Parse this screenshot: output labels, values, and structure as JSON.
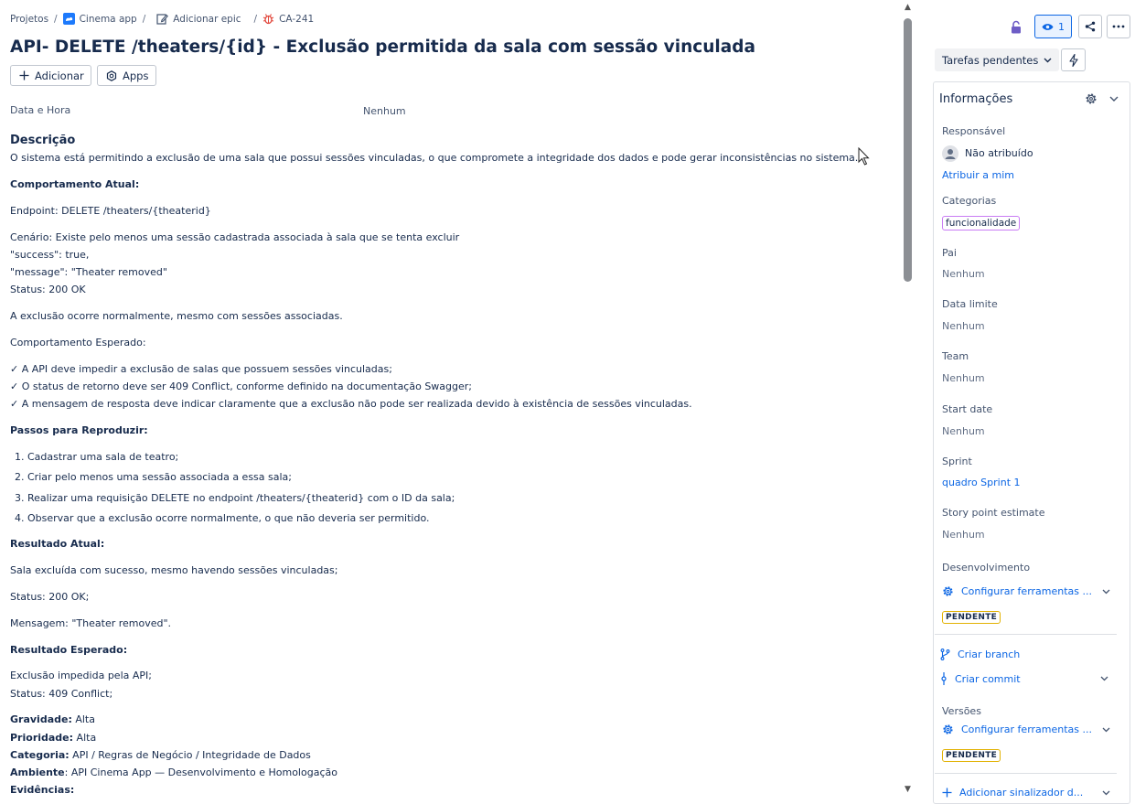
{
  "breadcrumb": {
    "projects": "Projetos",
    "project": "Cinema app",
    "epic": "Adicionar epic",
    "issue_key": "CA-241"
  },
  "issue": {
    "title": "API- DELETE /theaters/{id} - Exclusão permitida da sala com sessão vinculada",
    "add_button": "Adicionar",
    "apps_button": "Apps"
  },
  "fields": {
    "datetime_label": "Data e Hora",
    "datetime_value": "Nenhum"
  },
  "description": {
    "heading": "Descrição",
    "intro": "O sistema está permitindo a exclusão de uma sala que possui sessões vinculadas, o que compromete a integridade dos dados e pode gerar inconsistências no sistema.",
    "current_behavior_title": "Comportamento Atual:",
    "endpoint": "Endpoint: DELETE /theaters/{theaterid}",
    "scenario": "Cenário: Existe pelo menos uma sessão cadastrada associada à sala que se tenta excluir",
    "success_line": "\"success\": true,",
    "message_line": "\"message\": \"Theater removed\"",
    "status_line": "Status: 200 OK",
    "normal_deletion": "A exclusão ocorre normalmente, mesmo com sessões associadas.",
    "expected_behavior_title": "Comportamento Esperado:",
    "expected": [
      "✓ A API deve impedir a exclusão de salas que possuem sessões vinculadas;",
      "✓ O status de retorno deve ser 409 Conflict, conforme definido na documentação Swagger;",
      "✓ A mensagem de resposta deve indicar claramente que a exclusão não pode ser realizada devido à existência de sessões vinculadas."
    ],
    "steps_title": "Passos para Reproduzir:",
    "steps": [
      "Cadastrar uma sala de teatro;",
      "Criar pelo menos uma sessão associada a essa sala;",
      "Realizar uma requisição DELETE no endpoint /theaters/{theaterid} com o ID da sala;",
      "Observar que a exclusão ocorre normalmente, o que não deveria ser permitido."
    ],
    "actual_result_title": "Resultado Atual:",
    "actual_result_1": "Sala excluída com sucesso, mesmo havendo sessões vinculadas;",
    "actual_result_2": "Status: 200 OK;",
    "actual_result_3": "Mensagem: \"Theater removed\".",
    "expected_result_title": "Resultado Esperado:",
    "expected_result_1": "Exclusão impedida pela API;",
    "expected_result_2": "Status: 409 Conflict;",
    "severity_label": "Gravidade:",
    "severity_value": " Alta",
    "priority_label": "Prioridade:",
    "priority_value": " Alta",
    "category_label": "Categoria:",
    "category_value": " API / Regras de Negócio / Integridade de Dados",
    "environment_label": "Ambiente",
    "environment_value": ": API Cinema App — Desenvolvimento e Homologação",
    "evidence_label": "Evidências:"
  },
  "sidebar": {
    "watch_count": "1",
    "pending_tasks": "Tarefas pendentes",
    "info_title": "Informações",
    "assignee_label": "Responsável",
    "assignee_value": "Não atribuído",
    "assign_to_me": "Atribuir a mim",
    "categories_label": "Categorias",
    "category_tag": "funcionalidade",
    "parent_label": "Pai",
    "parent_value": "Nenhum",
    "due_date_label": "Data limite",
    "due_date_value": "Nenhum",
    "team_label": "Team",
    "team_value": "Nenhum",
    "start_date_label": "Start date",
    "start_date_value": "Nenhum",
    "sprint_label": "Sprint",
    "sprint_value": "quadro Sprint 1",
    "story_points_label": "Story point estimate",
    "story_points_value": "Nenhum",
    "development_label": "Desenvolvimento",
    "configure_tools": "Configurar ferramentas ...",
    "pending_badge": "PENDENTE",
    "create_branch": "Criar branch",
    "create_commit": "Criar commit",
    "versions_label": "Versões",
    "configure_tools_2": "Configurar ferramentas ...",
    "pending_badge_2": "PENDENTE",
    "add_flag": "Adicionar sinalizador d..."
  },
  "colors": {
    "link": "#0c66e4",
    "text": "#172b4d",
    "bug_icon": "#e2483d",
    "project_icon": "#1d7afc",
    "lock_icon": "#6e5dc6",
    "category_border": "#c97cf4",
    "pending_border": "#e2b203"
  }
}
